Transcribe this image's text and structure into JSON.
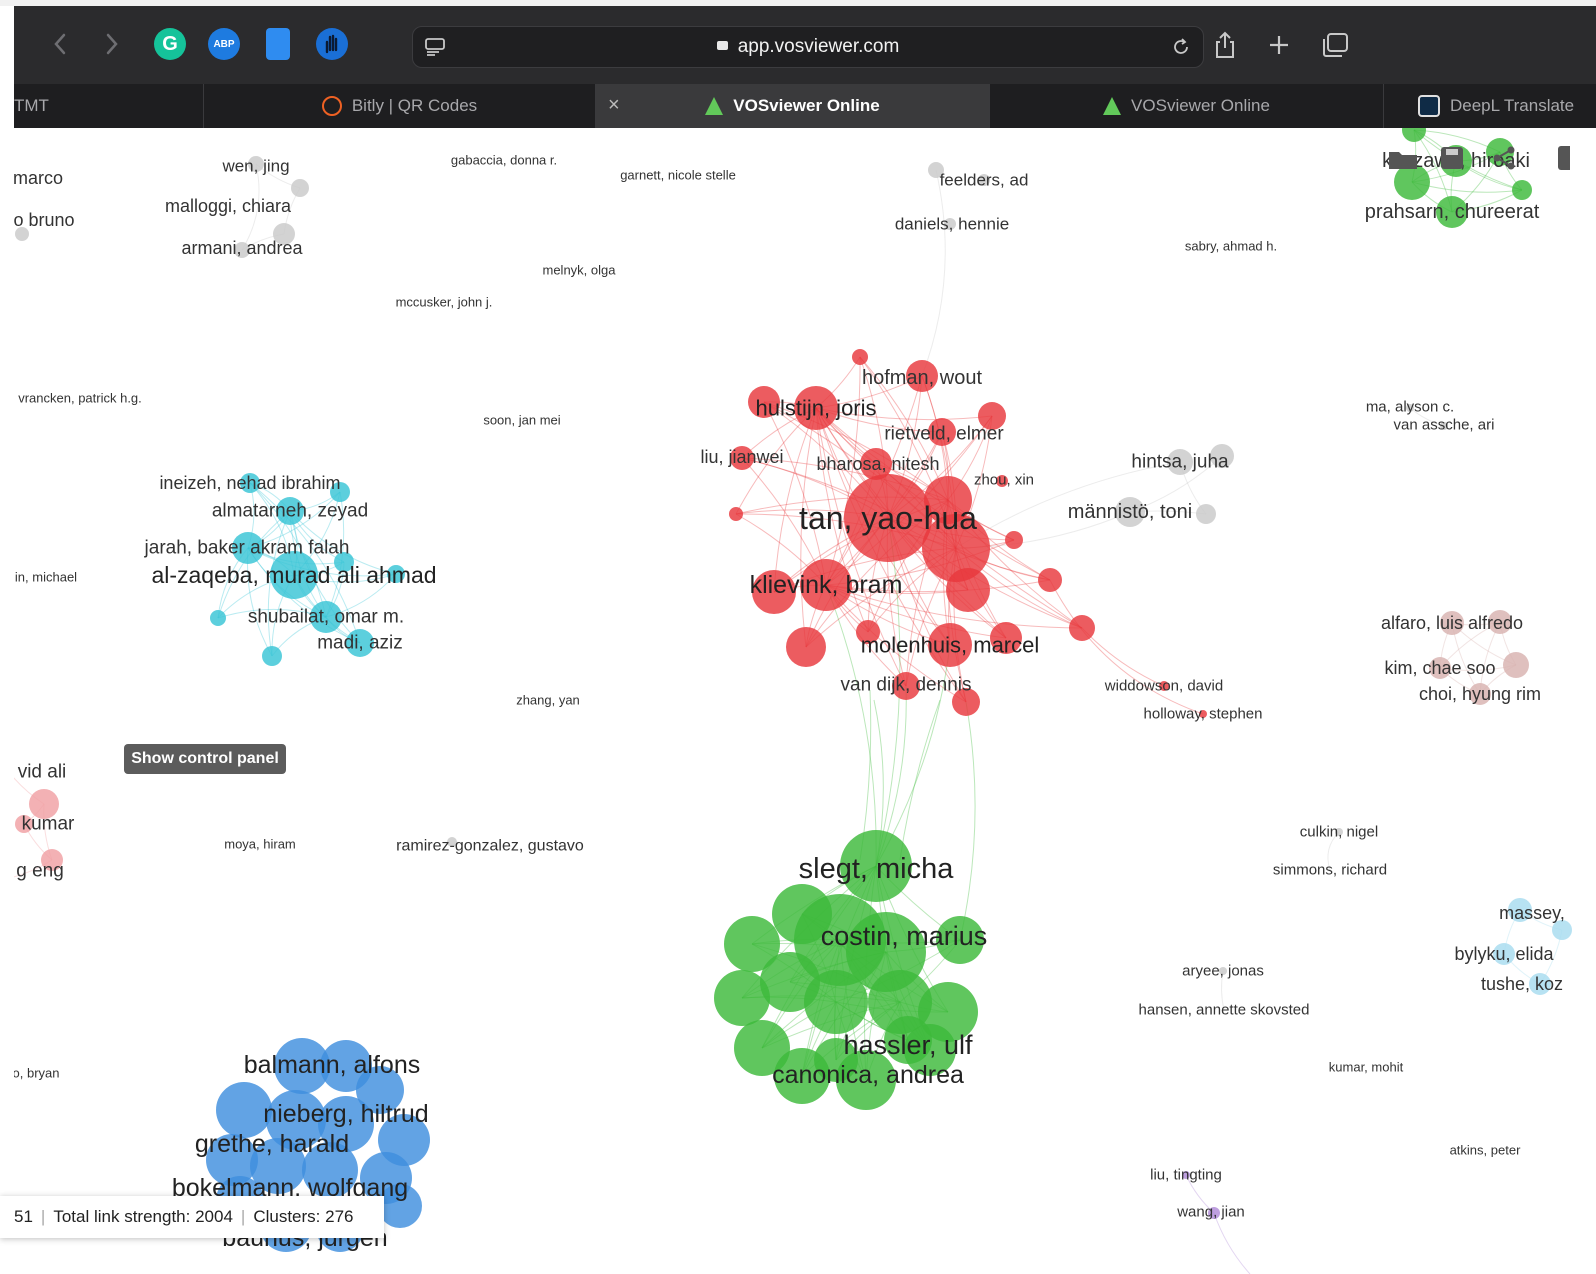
{
  "browser": {
    "url": "app.vosviewer.com",
    "tabs": [
      {
        "label": "TMT",
        "active": false
      },
      {
        "label": "Bitly | QR Codes",
        "active": false
      },
      {
        "label": "VOSviewer Online",
        "active": true
      },
      {
        "label": "VOSviewer Online",
        "active": false
      },
      {
        "label": "DeepL Translate",
        "active": false
      }
    ],
    "extensions": [
      "grammarly-icon",
      "adblock-plus-icon",
      "docs-icon",
      "hand-icon"
    ],
    "abp_label": "ABP",
    "grammarly_label": "G"
  },
  "controls": {
    "show_control_panel": "Show control panel"
  },
  "status": {
    "items_fragment": "51",
    "link_strength": "Total link strength: 2004",
    "clusters": "Clusters: 276"
  },
  "colors": {
    "red": "#e8383d",
    "green": "#3db93a",
    "blue": "#3f8fde",
    "cyan": "#38c5d6",
    "gray": "#c9c9c9",
    "pink": "#f0a0a3",
    "lightblue": "#a7dcef",
    "mauve": "#d8b2b0",
    "purple": "#b08ad8"
  },
  "nodes": [
    {
      "label": "marco",
      "size": 18,
      "c": "gray"
    },
    {
      "label": "o bruno",
      "size": 18,
      "c": "gray"
    },
    {
      "label": "wen, jing",
      "size": 17,
      "c": "gray"
    },
    {
      "label": "malloggi, chiara",
      "size": 18,
      "c": "gray"
    },
    {
      "label": "armani, andrea",
      "size": 18,
      "c": "gray"
    },
    {
      "label": "gabaccia, donna r.",
      "size": 13,
      "c": "gray"
    },
    {
      "label": "garnett, nicole stelle",
      "size": 13,
      "c": "gray"
    },
    {
      "label": "melnyk, olga",
      "size": 13,
      "c": "gray"
    },
    {
      "label": "mccusker, john j.",
      "size": 13,
      "c": "gray"
    },
    {
      "label": "feelders, ad",
      "size": 17,
      "c": "gray"
    },
    {
      "label": "daniels, hennie",
      "size": 17,
      "c": "gray"
    },
    {
      "label": "sabry, ahmad h.",
      "size": 13,
      "c": "gray"
    },
    {
      "label": "kitazawa, hiroaki",
      "size": 20,
      "c": "green"
    },
    {
      "label": "prahsarn, chureerat",
      "size": 20,
      "c": "green"
    },
    {
      "label": "vrancken, patrick h.g.",
      "size": 13,
      "c": "gray"
    },
    {
      "label": "soon, jan mei",
      "size": 13,
      "c": "gray"
    },
    {
      "label": "ma, alyson c.",
      "size": 15,
      "c": "gray"
    },
    {
      "label": "van assche, ari",
      "size": 15,
      "c": "gray"
    },
    {
      "label": "hofman, wout",
      "size": 20,
      "c": "red"
    },
    {
      "label": "hulstijn, joris",
      "size": 22,
      "c": "red"
    },
    {
      "label": "rietveld, elmer",
      "size": 19,
      "c": "red"
    },
    {
      "label": "liu, jianwei",
      "size": 18,
      "c": "red"
    },
    {
      "label": "bharosa, nitesh",
      "size": 18,
      "c": "red"
    },
    {
      "label": "zhou, xin",
      "size": 15,
      "c": "red"
    },
    {
      "label": "tan, yao-hua",
      "size": 32,
      "c": "red"
    },
    {
      "label": "klievink, bram",
      "size": 25,
      "c": "red"
    },
    {
      "label": "molenhuis, marcel",
      "size": 22,
      "c": "red"
    },
    {
      "label": "van dijk, dennis",
      "size": 19,
      "c": "red"
    },
    {
      "label": "hintsa, juha",
      "size": 19,
      "c": "gray"
    },
    {
      "label": "männistö, toni",
      "size": 20,
      "c": "gray"
    },
    {
      "label": "ineizeh, nehad ibrahim",
      "size": 18,
      "c": "cyan"
    },
    {
      "label": "almatarneh, zeyad",
      "size": 19,
      "c": "cyan"
    },
    {
      "label": "jarah, baker akram falah",
      "size": 19,
      "c": "cyan"
    },
    {
      "label": "al-zaqeba, murad ali ahmad",
      "size": 23,
      "c": "cyan"
    },
    {
      "label": "shubailat, omar m.",
      "size": 19,
      "c": "cyan"
    },
    {
      "label": "madi, aziz",
      "size": 19,
      "c": "cyan"
    },
    {
      "label": "in, michael",
      "size": 13,
      "c": "gray"
    },
    {
      "label": "alfaro, luis alfredo",
      "size": 18,
      "c": "mauve"
    },
    {
      "label": "kim, chae soo",
      "size": 18,
      "c": "mauve"
    },
    {
      "label": "choi, hyung rim",
      "size": 18,
      "c": "mauve"
    },
    {
      "label": "widdowson, david",
      "size": 15,
      "c": "red"
    },
    {
      "label": "holloway, stephen",
      "size": 15,
      "c": "red"
    },
    {
      "label": "zhang, yan",
      "size": 13,
      "c": "gray"
    },
    {
      "label": "vid ali",
      "size": 19,
      "c": "pink"
    },
    {
      "label": "kumar",
      "size": 19,
      "c": "pink"
    },
    {
      "label": "g eng",
      "size": 19,
      "c": "pink"
    },
    {
      "label": "moya, hiram",
      "size": 13,
      "c": "gray"
    },
    {
      "label": "ramirez-gonzalez, gustavo",
      "size": 16,
      "c": "gray"
    },
    {
      "label": "culkin, nigel",
      "size": 15,
      "c": "gray"
    },
    {
      "label": "simmons, richard",
      "size": 15,
      "c": "gray"
    },
    {
      "label": "slegt, micha",
      "size": 29,
      "c": "green"
    },
    {
      "label": "costin, marius",
      "size": 27,
      "c": "green"
    },
    {
      "label": "hassler, ulf",
      "size": 27,
      "c": "green"
    },
    {
      "label": "canonica, andrea",
      "size": 25,
      "c": "green"
    },
    {
      "label": "massey,",
      "size": 18,
      "c": "lightblue"
    },
    {
      "label": "bylyku, elida",
      "size": 18,
      "c": "lightblue"
    },
    {
      "label": "tushe, koz",
      "size": 18,
      "c": "lightblue"
    },
    {
      "label": "aryee, jonas",
      "size": 15,
      "c": "gray"
    },
    {
      "label": "hansen, annette skovsted",
      "size": 15,
      "c": "gray"
    },
    {
      "label": "kumar, mohit",
      "size": 13,
      "c": "gray"
    },
    {
      "label": "o, bryan",
      "size": 13,
      "c": "gray"
    },
    {
      "label": "balmann, alfons",
      "size": 25,
      "c": "blue"
    },
    {
      "label": "nieberg, hiltrud",
      "size": 25,
      "c": "blue"
    },
    {
      "label": "grethe, harald",
      "size": 25,
      "c": "blue"
    },
    {
      "label": "bokelmann, wolfgang",
      "size": 25,
      "c": "blue"
    },
    {
      "label": "bauhus, jürgen",
      "size": 25,
      "c": "blue"
    },
    {
      "label": "atkins, peter",
      "size": 13,
      "c": "gray"
    },
    {
      "label": "liu, tingting",
      "size": 15,
      "c": "purple"
    },
    {
      "label": "wang, jian",
      "size": 15,
      "c": "purple"
    }
  ]
}
